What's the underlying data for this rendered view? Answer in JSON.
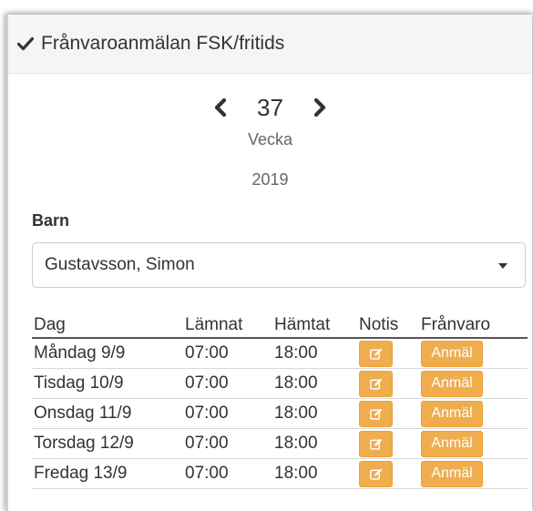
{
  "panel": {
    "title": "Frånvaroanmälan FSK/fritids"
  },
  "week": {
    "number": "37",
    "label": "Vecka",
    "year": "2019"
  },
  "child": {
    "label": "Barn",
    "selected": "Gustavsson, Simon"
  },
  "table": {
    "headers": [
      "Dag",
      "Lämnat",
      "Hämtat",
      "Notis",
      "Frånvaro"
    ],
    "rows": [
      {
        "day": "Måndag 9/9",
        "left": "07:00",
        "picked": "18:00",
        "action": "Anmäl"
      },
      {
        "day": "Tisdag 10/9",
        "left": "07:00",
        "picked": "18:00",
        "action": "Anmäl"
      },
      {
        "day": "Onsdag 11/9",
        "left": "07:00",
        "picked": "18:00",
        "action": "Anmäl"
      },
      {
        "day": "Torsdag 12/9",
        "left": "07:00",
        "picked": "18:00",
        "action": "Anmäl"
      },
      {
        "day": "Fredag 13/9",
        "left": "07:00",
        "picked": "18:00",
        "action": "Anmäl"
      }
    ]
  },
  "colors": {
    "warning": "#f0ad4e",
    "header_bg": "#f5f5f5",
    "text": "#333333"
  },
  "icons": {
    "title": "checkmark-icon",
    "prev": "chevron-left-icon",
    "next": "chevron-right-icon",
    "notis": "edit-icon",
    "select": "caret-down-icon"
  }
}
